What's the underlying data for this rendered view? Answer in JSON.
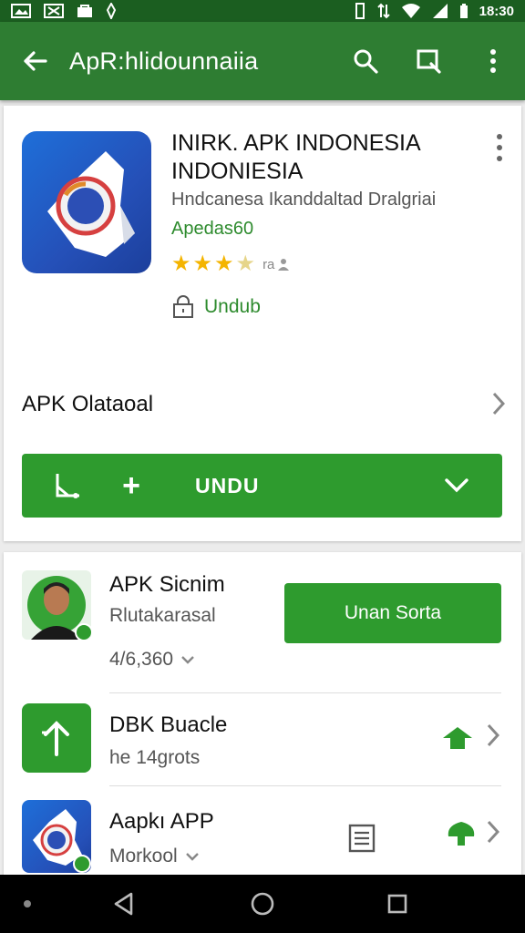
{
  "status_bar": {
    "time": "18:30",
    "left_icons": [
      "gallery-icon",
      "image-icon",
      "bag-icon",
      "notification-icon"
    ],
    "right_icons": [
      "vibrate-icon",
      "data-icon",
      "wifi-icon",
      "signal-icon",
      "battery-icon"
    ]
  },
  "app_bar": {
    "title": "ApR:hlidounnaiia",
    "icons": [
      "back-arrow-icon",
      "search-icon",
      "cast-icon",
      "more-vert-icon"
    ],
    "color": "#2e7d32"
  },
  "app_card": {
    "name": "INIRK. APK INDONESIA INDONIESIA",
    "developer": "Hndcanesa Ikanddaltad Dralgriai",
    "subtitle": "Apedas60",
    "rating_stars": 3.5,
    "rating_count": "ra",
    "install_label": "Undub",
    "section_title": "APK Olataoal",
    "download_label": "UNDU",
    "accent": "#2e9b2e"
  },
  "list": {
    "item1": {
      "title": "APK Sicnim",
      "subtitle": "Rlutakarasal",
      "count": "4/6,360",
      "button_label": "Unan Sorta"
    },
    "item2": {
      "title": "DBK Buacle",
      "subtitle": "he 14grots"
    },
    "item3": {
      "title": "Aapkı APP",
      "subtitle": "Morkool"
    }
  },
  "nav_bar": {
    "icons": [
      "back-triangle-icon",
      "home-circle-icon",
      "recents-square-icon"
    ]
  }
}
